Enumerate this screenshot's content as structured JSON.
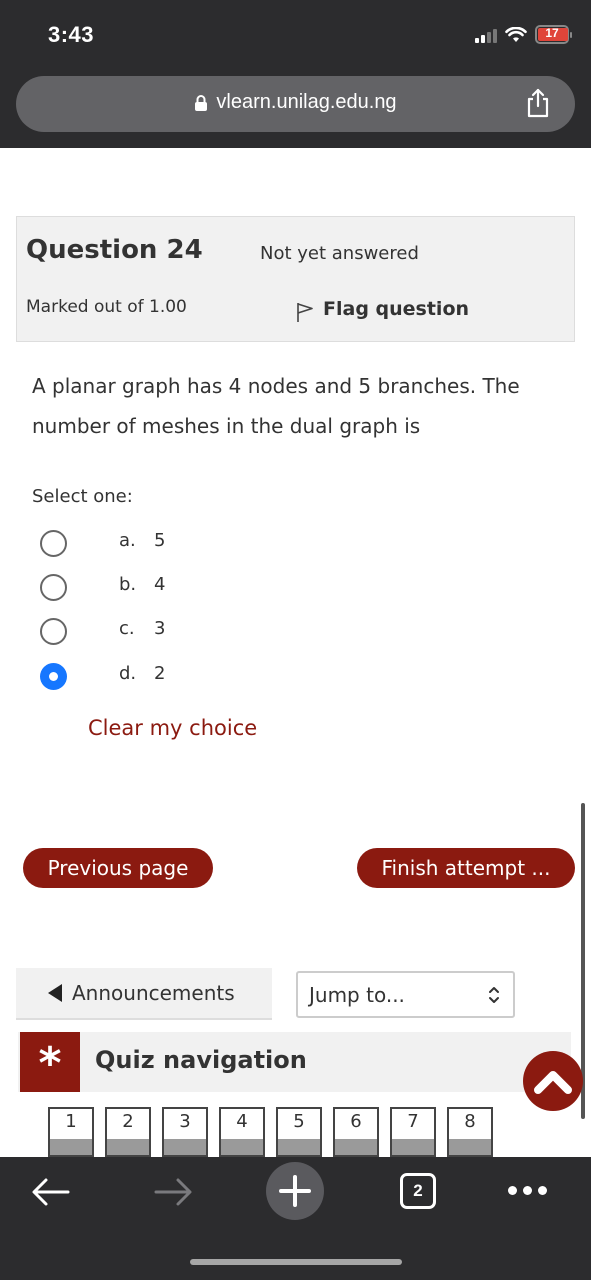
{
  "status_bar": {
    "time": "3:43",
    "battery": "17",
    "signal_icon": "cellular-signal-icon",
    "wifi_icon": "wifi-icon",
    "battery_color": "#e0453a"
  },
  "browser": {
    "url": "vlearn.unilag.edu.ng",
    "lock_icon": "lock-icon",
    "share_icon": "share-icon"
  },
  "question": {
    "label_prefix": "Question",
    "number": "24",
    "status": "Not yet answered",
    "marked_out_of": "Marked out of 1.00",
    "flag_label": "Flag question",
    "text": "A planar graph has 4 nodes and 5 branches. The number of meshes in the dual graph is",
    "select_prompt": "Select one:",
    "options": [
      {
        "letter": "a.",
        "value": "5",
        "selected": false
      },
      {
        "letter": "b.",
        "value": "4",
        "selected": false
      },
      {
        "letter": "c.",
        "value": "3",
        "selected": false
      },
      {
        "letter": "d.",
        "value": "2",
        "selected": true
      }
    ],
    "clear_label": "Clear my choice"
  },
  "navigation": {
    "previous_label": "Previous page",
    "finish_label": "Finish attempt ...",
    "announcements_label": "Announcements",
    "jump_placeholder": "Jump to...",
    "quiz_nav_title": "Quiz navigation",
    "asterisk": "*",
    "pages": [
      "1",
      "2",
      "3",
      "4",
      "5",
      "6",
      "7",
      "8"
    ]
  },
  "toolbar": {
    "tab_count": "2"
  },
  "colors": {
    "accent": "#8b1a10",
    "radio_selected": "#1677ff",
    "chrome": "#2c2c2e"
  }
}
